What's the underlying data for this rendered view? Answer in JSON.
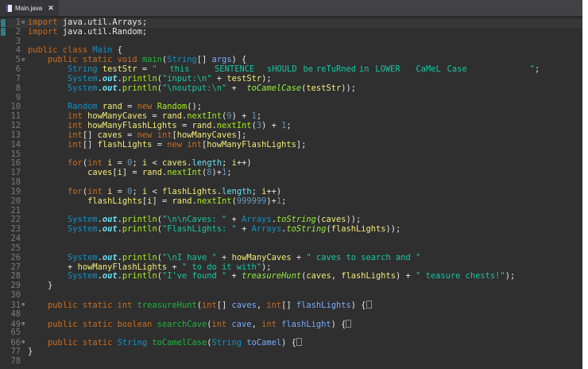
{
  "tab": {
    "title": "Main.java",
    "close": "✕"
  },
  "colors": {
    "background": "#2f2f2f",
    "keyword": "#cc6c1d",
    "type": "#1290c3",
    "string": "#17c6a3",
    "method": "#a7ec21",
    "variable": "#f3ec79"
  },
  "lines": [
    {
      "n": "1",
      "fold": "minus",
      "tokens": [
        [
          "k",
          "import"
        ],
        [
          "o",
          " java.util.Arrays;"
        ]
      ]
    },
    {
      "n": "2",
      "tokens": [
        [
          "k",
          "import"
        ],
        [
          "o",
          " java.util.Random;"
        ]
      ]
    },
    {
      "n": "3",
      "tokens": []
    },
    {
      "n": "4",
      "tokens": [
        [
          "k",
          "public class "
        ],
        [
          "t",
          "Main"
        ],
        [
          "o",
          " {"
        ]
      ]
    },
    {
      "n": "5",
      "fold": "minus",
      "tokens": [
        [
          "o",
          "    "
        ],
        [
          "k",
          "public static void "
        ],
        [
          "md",
          "main"
        ],
        [
          "o",
          "("
        ],
        [
          "t",
          "String"
        ],
        [
          "o",
          "[] "
        ],
        [
          "p",
          "args"
        ],
        [
          "o",
          ") {"
        ]
      ]
    },
    {
      "n": "6",
      "tokens": [
        [
          "o",
          "        "
        ],
        [
          "t",
          "String "
        ],
        [
          "v",
          "testStr"
        ],
        [
          "o",
          " = "
        ],
        [
          "s",
          "\"    this        SENTENCE    sHOULD  be reTuRned in  LOWER     CaMeL  Case                    \""
        ],
        [
          "o",
          ";"
        ]
      ]
    },
    {
      "n": "7",
      "tokens": [
        [
          "o",
          "        "
        ],
        [
          "t",
          "System"
        ],
        [
          "o",
          "."
        ],
        [
          "f",
          "out"
        ],
        [
          "o",
          "."
        ],
        [
          "m",
          "println"
        ],
        [
          "o",
          "("
        ],
        [
          "s",
          "\"input:\\n\""
        ],
        [
          "o",
          " + "
        ],
        [
          "v",
          "testStr"
        ],
        [
          "o",
          ");"
        ]
      ]
    },
    {
      "n": "8",
      "tokens": [
        [
          "o",
          "        "
        ],
        [
          "t",
          "System"
        ],
        [
          "o",
          "."
        ],
        [
          "f",
          "out"
        ],
        [
          "o",
          "."
        ],
        [
          "m",
          "println"
        ],
        [
          "o",
          "("
        ],
        [
          "s",
          "\"\\noutput:\\n\""
        ],
        [
          "o",
          " +  "
        ],
        [
          "sm",
          "toCamelCase"
        ],
        [
          "o",
          "("
        ],
        [
          "v",
          "testStr"
        ],
        [
          "o",
          "));"
        ]
      ]
    },
    {
      "n": "9",
      "tokens": []
    },
    {
      "n": "10",
      "tokens": [
        [
          "o",
          "        "
        ],
        [
          "t",
          "Random "
        ],
        [
          "v",
          "rand"
        ],
        [
          "o",
          " = "
        ],
        [
          "k",
          "new "
        ],
        [
          "m",
          "Random"
        ],
        [
          "o",
          "();"
        ]
      ]
    },
    {
      "n": "11",
      "tokens": [
        [
          "o",
          "        "
        ],
        [
          "k",
          "int "
        ],
        [
          "v",
          "howManyCaves"
        ],
        [
          "o",
          " = "
        ],
        [
          "v",
          "rand"
        ],
        [
          "o",
          "."
        ],
        [
          "m",
          "nextInt"
        ],
        [
          "o",
          "("
        ],
        [
          "n",
          "9"
        ],
        [
          "o",
          ") + "
        ],
        [
          "n",
          "1"
        ],
        [
          "o",
          ";"
        ]
      ]
    },
    {
      "n": "12",
      "tokens": [
        [
          "o",
          "        "
        ],
        [
          "k",
          "int "
        ],
        [
          "v",
          "howManyFlashLights"
        ],
        [
          "o",
          " = "
        ],
        [
          "v",
          "rand"
        ],
        [
          "o",
          "."
        ],
        [
          "m",
          "nextInt"
        ],
        [
          "o",
          "("
        ],
        [
          "n",
          "3"
        ],
        [
          "o",
          ") + "
        ],
        [
          "n",
          "1"
        ],
        [
          "o",
          ";"
        ]
      ]
    },
    {
      "n": "13",
      "tokens": [
        [
          "o",
          "        "
        ],
        [
          "k",
          "int"
        ],
        [
          "o",
          "[] "
        ],
        [
          "v",
          "caves"
        ],
        [
          "o",
          " = "
        ],
        [
          "k",
          "new int"
        ],
        [
          "o",
          "["
        ],
        [
          "v",
          "howManyCaves"
        ],
        [
          "o",
          "];"
        ]
      ]
    },
    {
      "n": "14",
      "tokens": [
        [
          "o",
          "        "
        ],
        [
          "k",
          "int"
        ],
        [
          "o",
          "[] "
        ],
        [
          "v",
          "flashLights"
        ],
        [
          "o",
          " = "
        ],
        [
          "k",
          "new int"
        ],
        [
          "o",
          "["
        ],
        [
          "v",
          "howManyFlashLights"
        ],
        [
          "o",
          "];"
        ]
      ]
    },
    {
      "n": "15",
      "tokens": []
    },
    {
      "n": "16",
      "tokens": [
        [
          "o",
          "        "
        ],
        [
          "k",
          "for"
        ],
        [
          "o",
          "("
        ],
        [
          "k",
          "int "
        ],
        [
          "v",
          "i"
        ],
        [
          "o",
          " = "
        ],
        [
          "n",
          "0"
        ],
        [
          "o",
          "; "
        ],
        [
          "v",
          "i"
        ],
        [
          "o",
          " < "
        ],
        [
          "v",
          "caves"
        ],
        [
          "o",
          "."
        ],
        [
          "fd",
          "length"
        ],
        [
          "o",
          "; "
        ],
        [
          "v",
          "i"
        ],
        [
          "o",
          "++)"
        ]
      ]
    },
    {
      "n": "17",
      "tokens": [
        [
          "o",
          "            "
        ],
        [
          "v",
          "caves"
        ],
        [
          "o",
          "["
        ],
        [
          "v",
          "i"
        ],
        [
          "o",
          "] = "
        ],
        [
          "v",
          "rand"
        ],
        [
          "o",
          "."
        ],
        [
          "m",
          "nextInt"
        ],
        [
          "o",
          "("
        ],
        [
          "n",
          "8"
        ],
        [
          "o",
          ")+"
        ],
        [
          "n",
          "1"
        ],
        [
          "o",
          ";"
        ]
      ]
    },
    {
      "n": "18",
      "tokens": []
    },
    {
      "n": "19",
      "tokens": [
        [
          "o",
          "        "
        ],
        [
          "k",
          "for"
        ],
        [
          "o",
          "("
        ],
        [
          "k",
          "int "
        ],
        [
          "v",
          "i"
        ],
        [
          "o",
          " = "
        ],
        [
          "n",
          "0"
        ],
        [
          "o",
          "; "
        ],
        [
          "v",
          "i"
        ],
        [
          "o",
          " < "
        ],
        [
          "v",
          "flashLights"
        ],
        [
          "o",
          "."
        ],
        [
          "fd",
          "length"
        ],
        [
          "o",
          "; "
        ],
        [
          "v",
          "i"
        ],
        [
          "o",
          "++)"
        ]
      ]
    },
    {
      "n": "20",
      "tokens": [
        [
          "o",
          "            "
        ],
        [
          "v",
          "flashLights"
        ],
        [
          "o",
          "["
        ],
        [
          "v",
          "i"
        ],
        [
          "o",
          "] = "
        ],
        [
          "v",
          "rand"
        ],
        [
          "o",
          "."
        ],
        [
          "m",
          "nextInt"
        ],
        [
          "o",
          "("
        ],
        [
          "n",
          "999999"
        ],
        [
          "o",
          ")+"
        ],
        [
          "n",
          "1"
        ],
        [
          "o",
          ";"
        ]
      ]
    },
    {
      "n": "21",
      "tokens": []
    },
    {
      "n": "22",
      "tokens": [
        [
          "o",
          "        "
        ],
        [
          "t",
          "System"
        ],
        [
          "o",
          "."
        ],
        [
          "f",
          "out"
        ],
        [
          "o",
          "."
        ],
        [
          "m",
          "println"
        ],
        [
          "o",
          "("
        ],
        [
          "s",
          "\"\\n\\nCaves: \""
        ],
        [
          "o",
          " + "
        ],
        [
          "t",
          "Arrays"
        ],
        [
          "o",
          "."
        ],
        [
          "sm",
          "toString"
        ],
        [
          "o",
          "("
        ],
        [
          "v",
          "caves"
        ],
        [
          "o",
          "));"
        ]
      ]
    },
    {
      "n": "23",
      "tokens": [
        [
          "o",
          "        "
        ],
        [
          "t",
          "System"
        ],
        [
          "o",
          "."
        ],
        [
          "f",
          "out"
        ],
        [
          "o",
          "."
        ],
        [
          "m",
          "println"
        ],
        [
          "o",
          "("
        ],
        [
          "s",
          "\"FlashLights: \""
        ],
        [
          "o",
          " + "
        ],
        [
          "t",
          "Arrays"
        ],
        [
          "o",
          "."
        ],
        [
          "sm",
          "toString"
        ],
        [
          "o",
          "("
        ],
        [
          "v",
          "flashLights"
        ],
        [
          "o",
          "));"
        ]
      ]
    },
    {
      "n": "24",
      "tokens": []
    },
    {
      "n": "25",
      "tokens": []
    },
    {
      "n": "26",
      "tokens": [
        [
          "o",
          "        "
        ],
        [
          "t",
          "System"
        ],
        [
          "o",
          "."
        ],
        [
          "f",
          "out"
        ],
        [
          "o",
          "."
        ],
        [
          "m",
          "println"
        ],
        [
          "o",
          "("
        ],
        [
          "s",
          "\"\\nI have \""
        ],
        [
          "o",
          " + "
        ],
        [
          "v",
          "howManyCaves"
        ],
        [
          "o",
          " + "
        ],
        [
          "s",
          "\" caves to search and \""
        ]
      ]
    },
    {
      "n": "27",
      "tokens": [
        [
          "o",
          "        + "
        ],
        [
          "v",
          "howManyFlashLights"
        ],
        [
          "o",
          " + "
        ],
        [
          "s",
          "\" to do it with\""
        ],
        [
          "o",
          ");"
        ]
      ]
    },
    {
      "n": "28",
      "tokens": [
        [
          "o",
          "        "
        ],
        [
          "t",
          "System"
        ],
        [
          "o",
          "."
        ],
        [
          "f",
          "out"
        ],
        [
          "o",
          "."
        ],
        [
          "m",
          "println"
        ],
        [
          "o",
          "("
        ],
        [
          "s",
          "\"I've found \""
        ],
        [
          "o",
          " + "
        ],
        [
          "sm",
          "treasureHunt"
        ],
        [
          "o",
          "("
        ],
        [
          "v",
          "caves"
        ],
        [
          "o",
          ", "
        ],
        [
          "v",
          "flashLights"
        ],
        [
          "o",
          ") + "
        ],
        [
          "s",
          "\" teasure chests!\""
        ],
        [
          "o",
          ");"
        ]
      ]
    },
    {
      "n": "29",
      "tokens": [
        [
          "o",
          "    }"
        ]
      ]
    },
    {
      "n": "30",
      "tokens": []
    },
    {
      "n": "31",
      "fold": "plus",
      "collapsed": true,
      "tokens": [
        [
          "o",
          "    "
        ],
        [
          "k",
          "public static int "
        ],
        [
          "md",
          "treasureHunt"
        ],
        [
          "o",
          "("
        ],
        [
          "k",
          "int"
        ],
        [
          "o",
          "[] "
        ],
        [
          "p",
          "caves"
        ],
        [
          "o",
          ", "
        ],
        [
          "k",
          "int"
        ],
        [
          "o",
          "[] "
        ],
        [
          "p",
          "flashLights"
        ],
        [
          "o",
          ") {"
        ]
      ]
    },
    {
      "n": "48",
      "tokens": []
    },
    {
      "n": "49",
      "fold": "plus",
      "collapsed": true,
      "tokens": [
        [
          "o",
          "    "
        ],
        [
          "k",
          "public static boolean "
        ],
        [
          "md",
          "searchCave"
        ],
        [
          "o",
          "("
        ],
        [
          "k",
          "int "
        ],
        [
          "p",
          "cave"
        ],
        [
          "o",
          ", "
        ],
        [
          "k",
          "int "
        ],
        [
          "p",
          "flashLight"
        ],
        [
          "o",
          ") {"
        ]
      ]
    },
    {
      "n": "65",
      "tokens": []
    },
    {
      "n": "66",
      "fold": "plus",
      "collapsed": true,
      "tokens": [
        [
          "o",
          "    "
        ],
        [
          "k",
          "public static "
        ],
        [
          "t",
          "String "
        ],
        [
          "md",
          "toCamelCase"
        ],
        [
          "o",
          "("
        ],
        [
          "t",
          "String "
        ],
        [
          "p",
          "toCamel"
        ],
        [
          "o",
          ") {"
        ]
      ]
    },
    {
      "n": "77",
      "tokens": [
        [
          "o",
          "}"
        ]
      ]
    },
    {
      "n": "78",
      "tokens": []
    }
  ]
}
